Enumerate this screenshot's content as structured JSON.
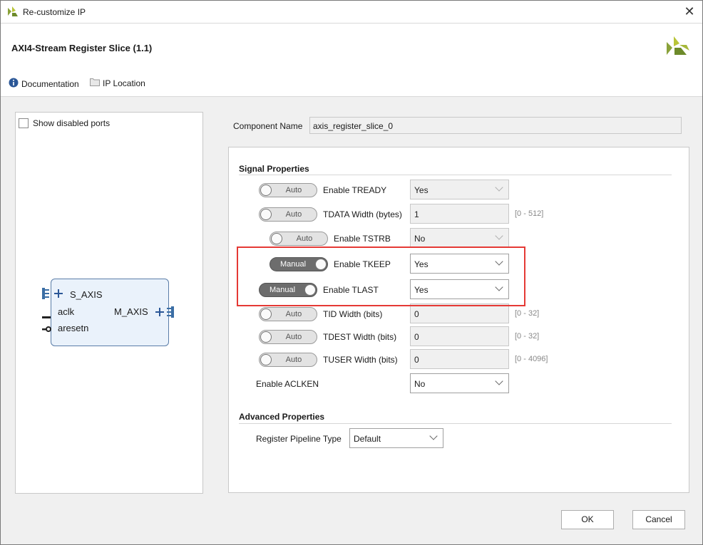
{
  "window": {
    "title": "Re-customize IP",
    "close_glyph": "✕"
  },
  "header": {
    "ip_title": "AXI4-Stream Register Slice (1.1)",
    "documentation_label": "Documentation",
    "ip_location_label": "IP Location"
  },
  "left_panel": {
    "show_disabled_ports_label": "Show disabled ports",
    "show_disabled_ports_checked": false,
    "block": {
      "port_s_axis": "S_AXIS",
      "port_aclk": "aclk",
      "port_aresetn": "aresetn",
      "port_m_axis": "M_AXIS"
    }
  },
  "component": {
    "label": "Component Name",
    "value": "axis_register_slice_0"
  },
  "signal_properties": {
    "heading": "Signal Properties",
    "rows": [
      {
        "toggle": "Auto",
        "label": "Enable TREADY",
        "value": "Yes",
        "type": "select",
        "enabled": false
      },
      {
        "toggle": "Auto",
        "label": "TDATA Width (bytes)",
        "value": "1",
        "type": "text",
        "enabled": false,
        "range": "[0 - 512]"
      },
      {
        "toggle": "Auto",
        "label": "Enable TSTRB",
        "value": "No",
        "type": "select",
        "enabled": false
      },
      {
        "toggle": "Manual",
        "label": "Enable TKEEP",
        "value": "Yes",
        "type": "select",
        "enabled": true
      },
      {
        "toggle": "Manual",
        "label": "Enable TLAST",
        "value": "Yes",
        "type": "select",
        "enabled": true
      },
      {
        "toggle": "Auto",
        "label": "TID Width (bits)",
        "value": "0",
        "type": "text",
        "enabled": false,
        "range": "[0 - 32]"
      },
      {
        "toggle": "Auto",
        "label": "TDEST Width (bits)",
        "value": "0",
        "type": "text",
        "enabled": false,
        "range": "[0 - 32]"
      },
      {
        "toggle": "Auto",
        "label": "TUSER Width (bits)",
        "value": "0",
        "type": "text",
        "enabled": false,
        "range": "[0 - 4096]"
      }
    ],
    "aclken": {
      "label": "Enable ACLKEN",
      "value": "No"
    }
  },
  "advanced_properties": {
    "heading": "Advanced Properties",
    "pipeline": {
      "label": "Register Pipeline Type",
      "value": "Default"
    }
  },
  "buttons": {
    "ok": "OK",
    "cancel": "Cancel"
  },
  "colors": {
    "highlight": "#e53935",
    "block_fill": "#eaf2fb",
    "block_border": "#5a7da8",
    "logo_green": "#8aa23a"
  }
}
